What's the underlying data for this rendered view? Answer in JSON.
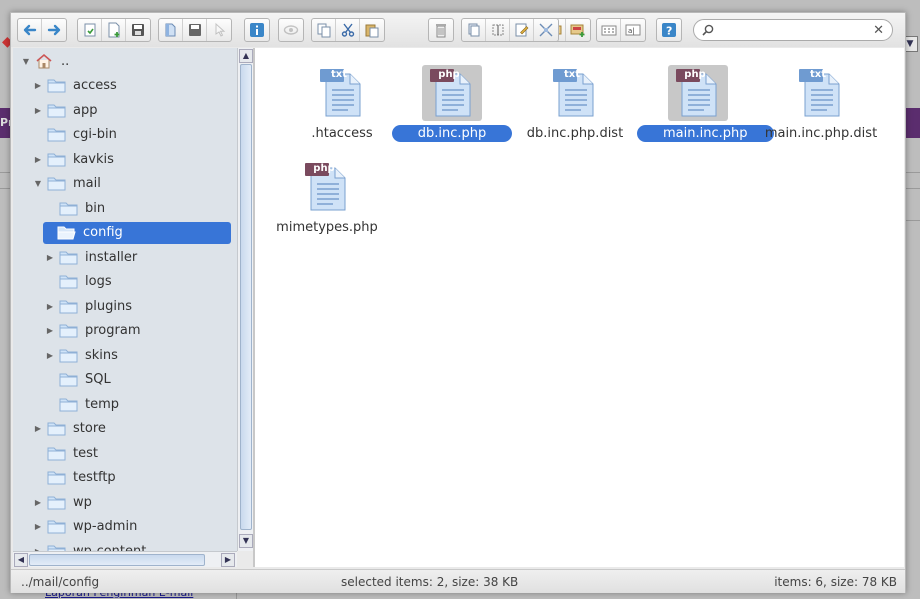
{
  "background": {
    "purple_bar_text": "Pr",
    "link_text": "Laporan Pengiriman E-mail"
  },
  "colors": {
    "selection": "#3875d7",
    "tree_bg": "#dde3e9",
    "bg_purple": "#5b2d6e"
  },
  "toolbar": {
    "groups": [
      {
        "buttons": [
          {
            "name": "back-icon"
          },
          {
            "name": "forward-icon"
          }
        ]
      },
      {
        "buttons": [
          {
            "name": "reload-icon"
          },
          {
            "name": "new-file-icon"
          },
          {
            "name": "save-icon"
          }
        ]
      },
      {
        "buttons": [
          {
            "name": "open-icon"
          },
          {
            "name": "download-icon"
          },
          {
            "name": "select-icon"
          }
        ]
      },
      {
        "buttons": [
          {
            "name": "info-icon"
          }
        ]
      },
      {
        "buttons": [
          {
            "name": "preview-icon"
          }
        ]
      },
      {
        "buttons": [
          {
            "name": "copy-icon"
          },
          {
            "name": "cut-icon"
          },
          {
            "name": "paste-icon"
          }
        ]
      },
      {
        "buttons": [
          {
            "name": "delete-icon"
          }
        ]
      },
      {
        "buttons": [
          {
            "name": "duplicate-icon"
          },
          {
            "name": "rename-icon"
          },
          {
            "name": "edit-icon"
          },
          {
            "name": "resize-icon"
          }
        ]
      },
      {
        "buttons": [
          {
            "name": "extract-icon"
          },
          {
            "name": "archive-icon"
          }
        ]
      },
      {
        "buttons": [
          {
            "name": "icons-view-icon"
          },
          {
            "name": "list-view-icon"
          }
        ]
      },
      {
        "buttons": [
          {
            "name": "help-icon"
          }
        ]
      }
    ]
  },
  "search": {
    "placeholder": "",
    "value": "",
    "clear_glyph": "✕"
  },
  "tree": {
    "items": [
      {
        "label": "..",
        "level": 0,
        "arrow": "▼",
        "icon": "home-icon"
      },
      {
        "label": "access",
        "level": 1,
        "arrow": "▶",
        "icon": "folder-icon"
      },
      {
        "label": "app",
        "level": 1,
        "arrow": "▶",
        "icon": "folder-icon"
      },
      {
        "label": "cgi-bin",
        "level": 1,
        "arrow": "",
        "icon": "folder-icon"
      },
      {
        "label": "kavkis",
        "level": 1,
        "arrow": "▶",
        "icon": "folder-icon"
      },
      {
        "label": "mail",
        "level": 1,
        "arrow": "▼",
        "icon": "folder-icon"
      },
      {
        "label": "bin",
        "level": 2,
        "arrow": "",
        "icon": "folder-icon"
      },
      {
        "label": "config",
        "level": 2,
        "arrow": "",
        "icon": "folder-open-icon",
        "selected": true
      },
      {
        "label": "installer",
        "level": 2,
        "arrow": "▶",
        "icon": "folder-icon"
      },
      {
        "label": "logs",
        "level": 2,
        "arrow": "",
        "icon": "folder-icon"
      },
      {
        "label": "plugins",
        "level": 2,
        "arrow": "▶",
        "icon": "folder-icon"
      },
      {
        "label": "program",
        "level": 2,
        "arrow": "▶",
        "icon": "folder-icon"
      },
      {
        "label": "skins",
        "level": 2,
        "arrow": "▶",
        "icon": "folder-icon"
      },
      {
        "label": "SQL",
        "level": 2,
        "arrow": "",
        "icon": "folder-icon"
      },
      {
        "label": "temp",
        "level": 2,
        "arrow": "",
        "icon": "folder-icon"
      },
      {
        "label": "store",
        "level": 1,
        "arrow": "▶",
        "icon": "folder-icon"
      },
      {
        "label": "test",
        "level": 1,
        "arrow": "",
        "icon": "folder-icon"
      },
      {
        "label": "testftp",
        "level": 1,
        "arrow": "",
        "icon": "folder-icon"
      },
      {
        "label": "wp",
        "level": 1,
        "arrow": "▶",
        "icon": "folder-icon"
      },
      {
        "label": "wp-admin",
        "level": 1,
        "arrow": "▶",
        "icon": "folder-icon"
      },
      {
        "label": "wp-content",
        "level": 1,
        "arrow": "▶",
        "icon": "folder-icon"
      }
    ]
  },
  "files": [
    {
      "name": ".htaccess",
      "type": "txt",
      "selected": false
    },
    {
      "name": "db.inc.php",
      "type": "php",
      "selected": true
    },
    {
      "name": "db.inc.php.dist",
      "type": "txt",
      "selected": false
    },
    {
      "name": "main.inc.php",
      "type": "php",
      "selected": true
    },
    {
      "name": "main.inc.php.dist",
      "type": "txt",
      "selected": false
    },
    {
      "name": "mimetypes.php",
      "type": "php",
      "selected": false
    }
  ],
  "status": {
    "path": "../mail/config",
    "selected": "selected items: 2, size: 38 KB",
    "total": "items: 6, size: 78 KB"
  }
}
